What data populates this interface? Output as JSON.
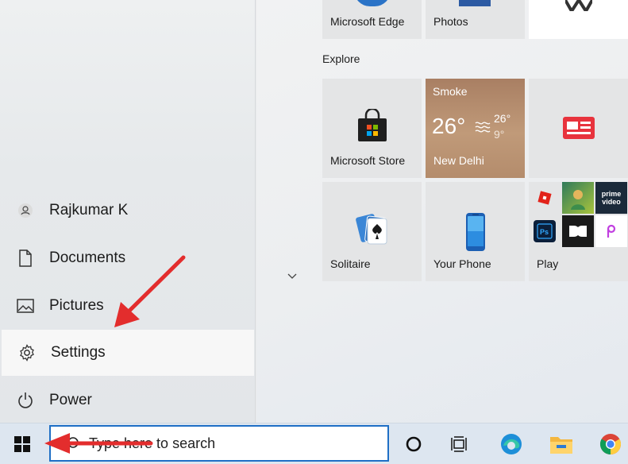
{
  "left_nav": {
    "items": [
      {
        "label": "Rajkumar K",
        "icon": "user-icon"
      },
      {
        "label": "Documents",
        "icon": "document-icon"
      },
      {
        "label": "Pictures",
        "icon": "pictures-icon"
      },
      {
        "label": "Settings",
        "icon": "gear-icon",
        "active": true
      },
      {
        "label": "Power",
        "icon": "power-icon"
      }
    ]
  },
  "tiles": {
    "top_row": [
      {
        "label": "Microsoft Edge"
      },
      {
        "label": "Photos"
      }
    ],
    "group_label": "Explore",
    "microsoft_store": {
      "label": "Microsoft Store"
    },
    "weather": {
      "condition": "Smoke",
      "temp": "26°",
      "high": "26°",
      "low": "9°",
      "city": "New Delhi"
    },
    "news": {
      "label": ""
    },
    "solitaire": {
      "label": "Solitaire"
    },
    "your_phone": {
      "label": "Your Phone"
    },
    "play": {
      "label": "Play",
      "apps": [
        "roblox",
        "game",
        "prime video",
        "photoshop express",
        "dolby",
        "picsart"
      ]
    }
  },
  "taskbar": {
    "search_placeholder": "Type here to search",
    "icons": [
      "cortana-icon",
      "task-view-icon",
      "edge-icon",
      "file-explorer-icon",
      "chrome-icon"
    ]
  },
  "annotations": [
    "arrow-to-settings",
    "arrow-to-start"
  ],
  "colors": {
    "accent_red": "#e32d2d",
    "search_border": "#1f6fc5",
    "weather_tile": "#b48c6c"
  }
}
